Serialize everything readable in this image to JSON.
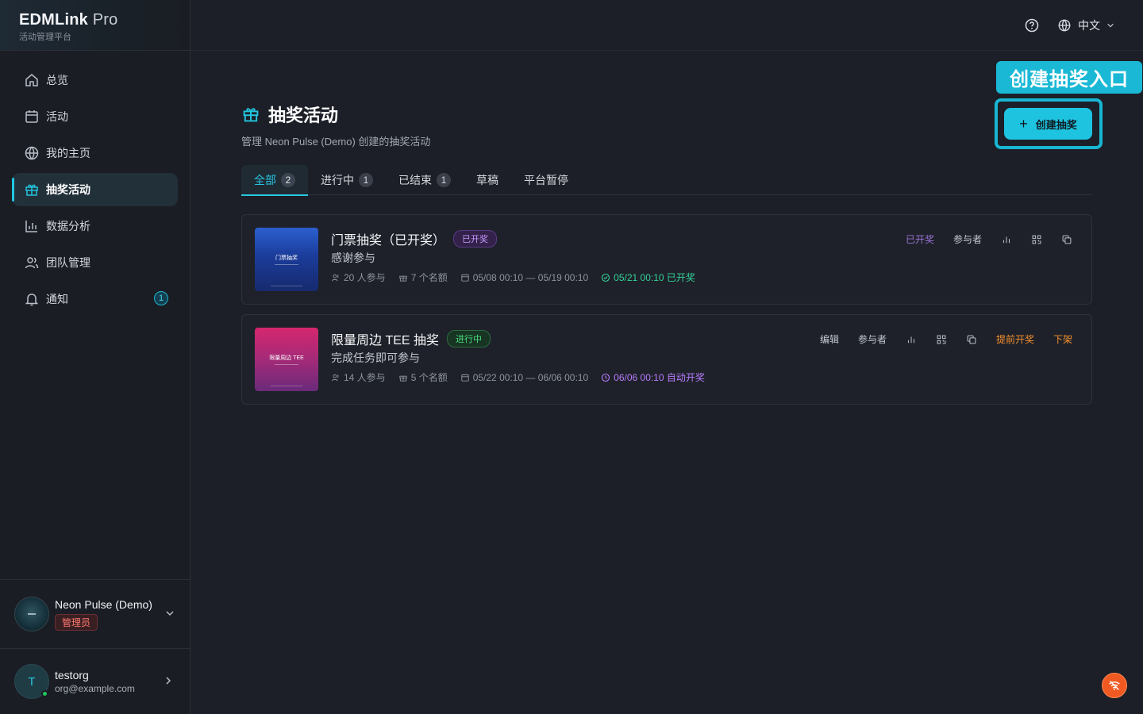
{
  "brand": {
    "name": "EDMLink",
    "suffix": "Pro",
    "subtitle": "活动管理平台"
  },
  "topbar": {
    "language": "中文"
  },
  "sidebar": {
    "items": [
      {
        "label": "总览",
        "icon": "home-icon"
      },
      {
        "label": "活动",
        "icon": "calendar-icon"
      },
      {
        "label": "我的主页",
        "icon": "globe-icon"
      },
      {
        "label": "抽奖活动",
        "icon": "gift-icon",
        "active": true
      },
      {
        "label": "数据分析",
        "icon": "chart-icon"
      },
      {
        "label": "团队管理",
        "icon": "team-icon"
      },
      {
        "label": "通知",
        "icon": "bell-icon",
        "badge": "1"
      }
    ],
    "org": {
      "name": "Neon Pulse (Demo)",
      "role": "管理员"
    },
    "user": {
      "initial": "T",
      "name": "testorg",
      "email": "org@example.com"
    }
  },
  "page": {
    "title": "抽奖活动",
    "subtitle": "管理 Neon Pulse (Demo) 创建的抽奖活动",
    "callout": "创建抽奖入口",
    "create_label": "创建抽奖"
  },
  "tabs": [
    {
      "label": "全部",
      "count": "2",
      "active": true
    },
    {
      "label": "进行中",
      "count": "1"
    },
    {
      "label": "已结束",
      "count": "1"
    },
    {
      "label": "草稿"
    },
    {
      "label": "平台暂停"
    }
  ],
  "lotteries": [
    {
      "title": "门票抽奖（已开奖）",
      "status": "已开奖",
      "description": "感谢参与",
      "thumb_text": "门票抽奖",
      "participants": "20 人参与",
      "slots": "7 个名额",
      "period": "05/08 00:10 — 05/19 00:10",
      "draw": "05/21 00:10 已开奖",
      "actions": {
        "status": "已开奖",
        "participants": "参与者"
      }
    },
    {
      "title": "限量周边 TEE 抽奖",
      "status": "进行中",
      "description": "完成任务即可参与",
      "thumb_text": "限量周边 TEE",
      "participants": "14 人参与",
      "slots": "5 个名额",
      "period": "05/22 00:10 — 06/06 00:10",
      "draw": "06/06 00:10 自动开奖",
      "actions": {
        "edit": "编辑",
        "participants": "参与者",
        "draw_early": "提前开奖",
        "unpublish": "下架"
      }
    }
  ],
  "colors": {
    "accent": "#1ec3e0",
    "danger": "#f05a22"
  }
}
